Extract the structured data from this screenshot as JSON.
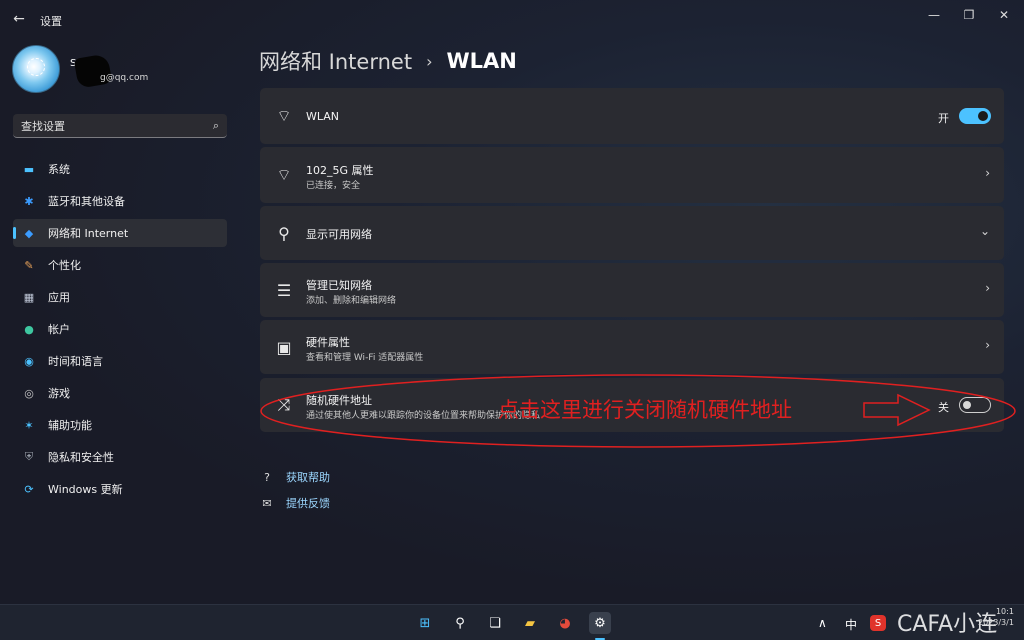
{
  "window": {
    "title": "设置",
    "back_glyph": "←",
    "min_glyph": "—",
    "max_glyph": "❐",
    "close_glyph": "✕"
  },
  "profile": {
    "name": "S",
    "email": "g@qq.com"
  },
  "search": {
    "placeholder": "查找设置",
    "icon": "search-icon",
    "glyph": "⌕"
  },
  "sidebar": {
    "items": [
      {
        "label": "系统",
        "icon": "monitor-icon",
        "glyph": "▬",
        "color": "#4cc2ff",
        "active": false
      },
      {
        "label": "蓝牙和其他设备",
        "icon": "bluetooth-icon",
        "glyph": "✱",
        "color": "#3b9cff",
        "active": false
      },
      {
        "label": "网络和 Internet",
        "icon": "network-icon",
        "glyph": "◆",
        "color": "#3b9cff",
        "active": true
      },
      {
        "label": "个性化",
        "icon": "brush-icon",
        "glyph": "✎",
        "color": "#e8a25a",
        "active": false
      },
      {
        "label": "应用",
        "icon": "apps-icon",
        "glyph": "▦",
        "color": "#c0c8d8",
        "active": false
      },
      {
        "label": "帐户",
        "icon": "account-icon",
        "glyph": "●",
        "color": "#3ec7a0",
        "active": false
      },
      {
        "label": "时间和语言",
        "icon": "globe-clock-icon",
        "glyph": "◉",
        "color": "#4cc2ff",
        "active": false
      },
      {
        "label": "游戏",
        "icon": "gamepad-icon",
        "glyph": "◎",
        "color": "#c8c8c8",
        "active": false
      },
      {
        "label": "辅助功能",
        "icon": "accessibility-icon",
        "glyph": "✶",
        "color": "#4cc2ff",
        "active": false
      },
      {
        "label": "隐私和安全性",
        "icon": "shield-icon",
        "glyph": "⛨",
        "color": "#9aa0aa",
        "active": false
      },
      {
        "label": "Windows 更新",
        "icon": "update-icon",
        "glyph": "⟳",
        "color": "#4cc2ff",
        "active": false
      }
    ]
  },
  "header": {
    "parent": "网络和 Internet",
    "separator": "›",
    "current": "WLAN"
  },
  "cards": {
    "wlan": {
      "title": "WLAN",
      "toggle_label": "开",
      "toggle_on": true,
      "icon_glyph": "⌔"
    },
    "network": {
      "title": "102_5G 属性",
      "subtitle": "已连接，安全",
      "icon_glyph": "⌔",
      "chevron": "›"
    },
    "available": {
      "title": "显示可用网络",
      "icon_glyph": "⚲",
      "chevron": "⌄"
    },
    "known": {
      "title": "管理已知网络",
      "subtitle": "添加、删除和编辑网络",
      "icon_glyph": "☰",
      "chevron": "›"
    },
    "hardware": {
      "title": "硬件属性",
      "subtitle": "查看和管理 Wi-Fi 适配器属性",
      "icon_glyph": "▣",
      "chevron": "›"
    },
    "random_mac": {
      "title": "随机硬件地址",
      "subtitle": "通过使其他人更难以跟踪你的设备位置来帮助保护你的隐私",
      "toggle_label": "关",
      "toggle_on": false,
      "icon_glyph": "⤨"
    }
  },
  "links": {
    "help": {
      "label": "获取帮助",
      "glyph": "?"
    },
    "feedback": {
      "label": "提供反馈",
      "glyph": "✉"
    }
  },
  "annotation": {
    "text": "点击这里进行关闭随机硬件地址",
    "color": "#e02020"
  },
  "taskbar": {
    "ime": "中",
    "tray_up": "∧",
    "watermark": "CAFA小连",
    "clock_time": "10:1",
    "clock_date": "2023/3/1",
    "accent": "#4cc2ff"
  }
}
